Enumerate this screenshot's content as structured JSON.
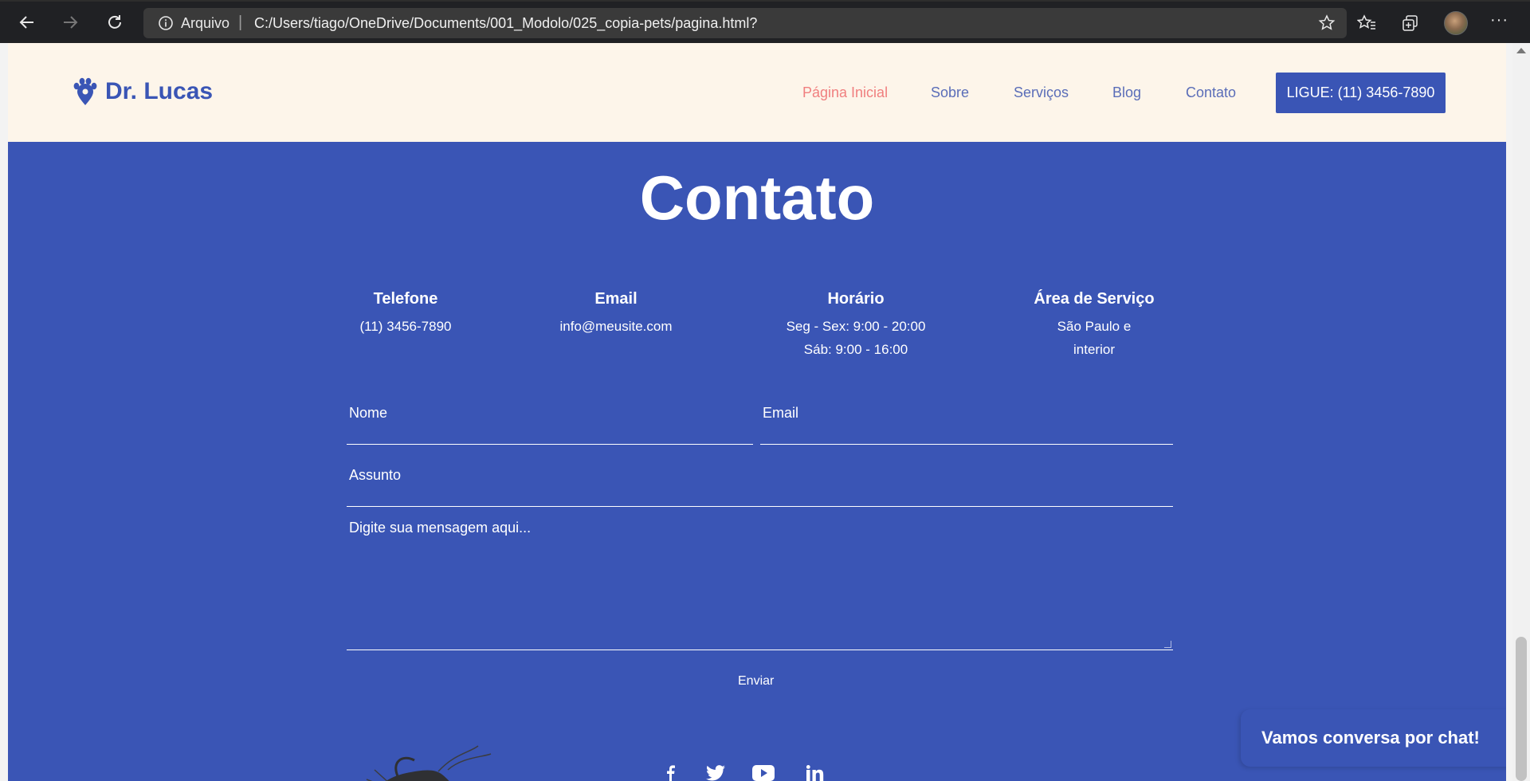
{
  "browser": {
    "address_label": "Arquivo",
    "url": "C:/Users/tiago/OneDrive/Documents/001_Modolo/025_copia-pets/pagina.html?"
  },
  "header": {
    "logo_text": "Dr. Lucas",
    "nav": [
      "Página Inicial",
      "Sobre",
      "Serviços",
      "Blog",
      "Contato"
    ],
    "cta_label": "LIGUE: (11) 3456-7890"
  },
  "contact": {
    "title": "Contato",
    "info": [
      {
        "heading": "Telefone",
        "lines": [
          "(11) 3456-7890"
        ]
      },
      {
        "heading": "Email",
        "lines": [
          "info@meusite.com"
        ]
      },
      {
        "heading": "Horário",
        "lines": [
          "Seg - Sex: 9:00 - 20:00",
          "Sáb: 9:00 - 16:00"
        ]
      },
      {
        "heading": "Área de Serviço",
        "lines": [
          "São Paulo e",
          "interior"
        ]
      }
    ],
    "form": {
      "name_placeholder": "Nome",
      "email_placeholder": "Email",
      "subject_placeholder": "Assunto",
      "message_placeholder": "Digite sua mensagem aqui...",
      "submit_label": "Enviar"
    }
  },
  "chat": {
    "label": "Vamos conversa por chat!"
  },
  "social": {
    "icons": [
      "facebook-icon",
      "twitter-icon",
      "youtube-icon",
      "linkedin-icon"
    ]
  },
  "colors": {
    "primary": "#3a55b5",
    "header_bg": "#fdf5ea",
    "active_nav": "#f07f7f"
  }
}
